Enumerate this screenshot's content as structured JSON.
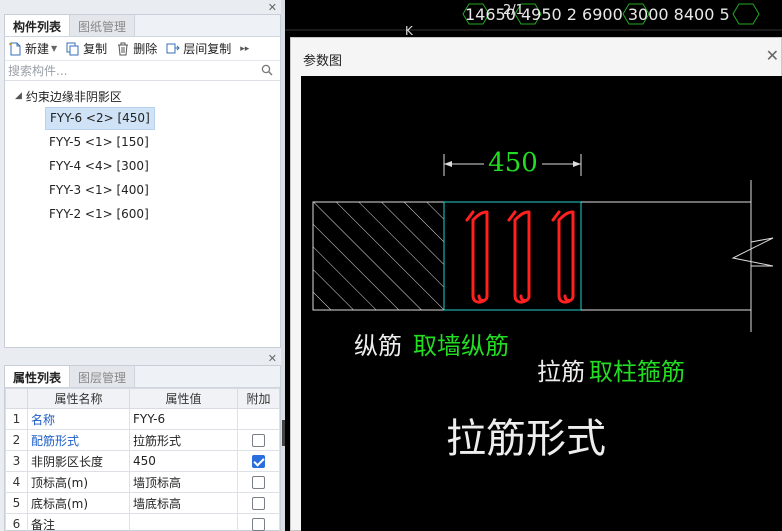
{
  "component_panel": {
    "tabs": [
      "构件列表",
      "图纸管理"
    ],
    "toolbar": {
      "new_label": "新建",
      "copy_label": "复制",
      "delete_label": "删除",
      "floor_copy_label": "层间复制",
      "more_label": "▸▸"
    },
    "search_placeholder": "搜索构件...",
    "tree": {
      "root_label": "约束边缘非阴影区",
      "items": [
        {
          "label": "FYY-6 <2> [450]"
        },
        {
          "label": "FYY-5 <1> [150]"
        },
        {
          "label": "FYY-4 <4> [300]"
        },
        {
          "label": "FYY-3 <1> [400]"
        },
        {
          "label": "FYY-2 <1> [600]"
        }
      ]
    }
  },
  "property_panel": {
    "tabs": [
      "属性列表",
      "图层管理"
    ],
    "headers": {
      "name": "属性名称",
      "value": "属性值",
      "extra": "附加"
    },
    "rows": [
      {
        "num": "1",
        "name": "名称",
        "value": "FYY-6",
        "checked": null
      },
      {
        "num": "2",
        "name": "配筋形式",
        "value": "拉筋形式",
        "checked": false
      },
      {
        "num": "3",
        "name": "非阴影区长度",
        "value": "450",
        "checked": true
      },
      {
        "num": "4",
        "name": "顶标高(m)",
        "value": "墙顶标高",
        "checked": false
      },
      {
        "num": "5",
        "name": "底标高(m)",
        "value": "墙底标高",
        "checked": false
      },
      {
        "num": "6",
        "name": "备注",
        "value": "",
        "checked": false
      }
    ]
  },
  "cad": {
    "axis_numbers": "14650 4950 2 6900 3000  8400   5",
    "axis_extra": "2/1",
    "axis_k": "K"
  },
  "dialog": {
    "title": "参数图",
    "close": "✕",
    "dimension": "450",
    "label_longitudinal_prefix": "纵筋",
    "label_longitudinal_value": "取墙纵筋",
    "label_tie_prefix": "拉筋",
    "label_tie_value": "取柱箍筋",
    "caption": "拉筋形式"
  },
  "colors": {
    "accent_blue": "#1b5cc8",
    "cad_green": "#22dd22",
    "cad_red": "#ff2020",
    "cad_cyan": "#20d0d0"
  }
}
